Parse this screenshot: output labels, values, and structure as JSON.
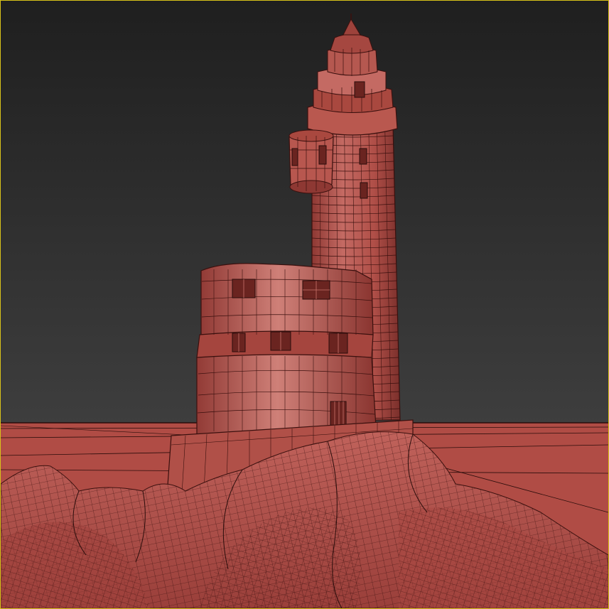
{
  "viewport": {
    "active": true,
    "render_mode": "wireframe-on-shaded",
    "colors": {
      "background_top": "#222222",
      "background_bottom": "#3c3c3c",
      "mesh_fill": "#b5524c",
      "mesh_fill_light": "#c9736b",
      "mesh_fill_dark": "#8e3833",
      "wire": "#3a100e",
      "ground_fill": "#b04c45",
      "ground_wire": "#2a0d0b",
      "active_border": "#d8c21a"
    }
  },
  "scene": {
    "objects": [
      "ground-plane",
      "lighthouse-tower",
      "lantern-room",
      "side-turret",
      "keeper-house",
      "base-platform",
      "rock-formation"
    ]
  }
}
